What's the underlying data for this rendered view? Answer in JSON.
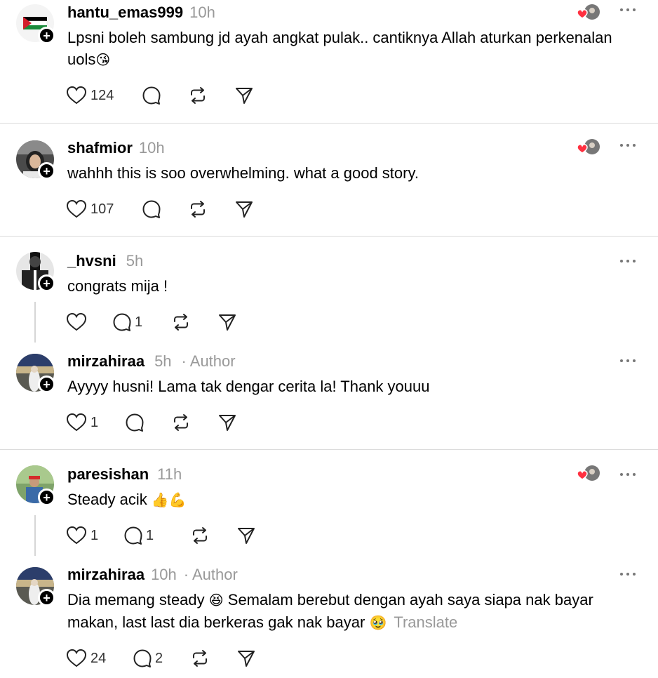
{
  "posts": [
    {
      "username": "hantu_emas999",
      "time": "10h",
      "text": "Lpsni boleh sambung jd ayah angkat pulak.. cantiknya Allah aturkan perkenalan uols",
      "emoji": "😘",
      "likes": "124",
      "replies": "",
      "liked_by_author": true
    },
    {
      "username": "shafmior",
      "time": "10h",
      "text": "wahhh this is soo overwhelming. what a good story.",
      "likes": "107",
      "replies": "",
      "liked_by_author": true
    },
    {
      "username": "_hvsni",
      "time": "5h",
      "text": "congrats mija !",
      "likes": "",
      "replies": "1",
      "liked_by_author": false
    },
    {
      "username": "mirzahiraa",
      "time": "5h",
      "author_tag": "· Author",
      "text": "Ayyyy husni! Lama tak dengar cerita la! Thank youuu",
      "likes": "1",
      "replies": "",
      "liked_by_author": false
    },
    {
      "username": "paresishan",
      "time": "11h",
      "text": "Steady acik",
      "emoji": "👍💪",
      "likes": "1",
      "replies": "1",
      "liked_by_author": true
    },
    {
      "username": "mirzahiraa",
      "time": "10h",
      "author_tag": "· Author",
      "text": "Dia memang steady",
      "emoji": "😆",
      "text2": "Semalam berebut dengan ayah saya siapa nak bayar makan, last last dia berkeras gak nak bayar",
      "emoji2": "🥹",
      "translate_label": "Translate",
      "likes": "24",
      "replies": "2",
      "liked_by_author": false
    }
  ],
  "colors": {
    "heart_red": "#ff3040",
    "muted": "#999999",
    "divider": "#dcdcdc"
  },
  "icons": {
    "like": "heart-icon",
    "reply": "speech-bubble-icon",
    "repost": "repost-icon",
    "share": "send-icon",
    "more": "more-horizontal-icon",
    "follow": "plus-icon"
  }
}
